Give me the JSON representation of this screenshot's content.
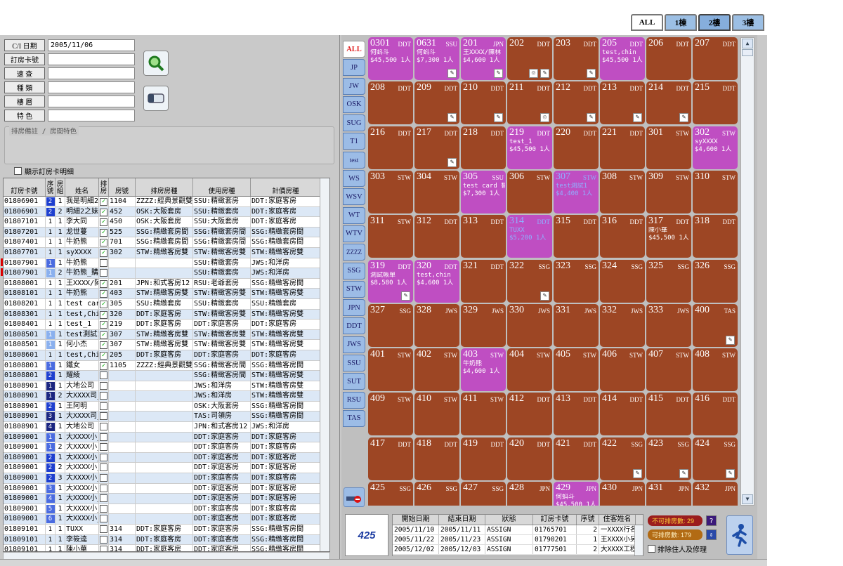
{
  "floor_tabs": [
    "ALL",
    "1棟",
    "2樓",
    "3樓"
  ],
  "form": {
    "labels": [
      "C/I 日期",
      "訂房卡號",
      "速 查",
      "種 類",
      "樓 層",
      "特 色"
    ],
    "values": [
      "2005/11/06",
      "",
      "",
      "",
      "",
      ""
    ],
    "note_label": "排房備註 / 房間特色",
    "show_card_detail": "顯示訂房卡明細"
  },
  "grid": {
    "headers": [
      "訂房卡號",
      "序號",
      "房組",
      "姓名",
      "排房",
      "房號",
      "排房房種",
      "使用房種",
      "計價房種"
    ],
    "rows": [
      [
        "01806901",
        "2",
        "b2",
        "1",
        "我是明細2",
        "c",
        "1104",
        "ZZZZ:經典景觀雙",
        "SSU:精緻套房",
        "DDT:家庭客房"
      ],
      [
        "01806901",
        "2",
        "b2",
        "2",
        "明細2之妹",
        "c",
        "452",
        "OSK:大阪套房",
        "SSU:精緻套房",
        "DDT:家庭客房"
      ],
      [
        "01807101",
        "1",
        "b0",
        "1",
        "李大同",
        "c",
        "450",
        "OSK:大阪套房",
        "SSU:大阪套房",
        "DDT:家庭客房"
      ],
      [
        "01807201",
        "1",
        "b0",
        "1",
        "龙世蔓",
        "c",
        "525",
        "SSG:精緻套房間",
        "SSG:精緻套房間",
        "SSG:精緻套房間"
      ],
      [
        "01807401",
        "1",
        "b0",
        "1",
        "牛奶熊",
        "c",
        "701",
        "SSG:精緻套房間",
        "SSG:精緻套房間",
        "SSG:精緻套房間"
      ],
      [
        "01807701",
        "1",
        "b0",
        "1",
        "syXXXX",
        "c",
        "302",
        "STW:精緻客房雙",
        "STW:精緻客房雙",
        "STW:精緻客房雙"
      ],
      [
        "01807901",
        "1",
        "b1",
        "1",
        "牛奶熊",
        "u",
        "",
        "",
        "SSU:精緻套房",
        "JWS:和洋房"
      ],
      [
        "01807901",
        "1",
        "bl",
        "2",
        "牛奶熊_購物",
        "u",
        "",
        "",
        "SSU:精緻套房",
        "JWS:和洋房"
      ],
      [
        "01808001",
        "1",
        "b0",
        "1",
        "王XXXX/陳林",
        "c",
        "201",
        "JPN:和式客房12",
        "RSU:老爺套房",
        "SSG:精緻客房間"
      ],
      [
        "01808101",
        "1",
        "b0",
        "1",
        "牛奶熊",
        "c",
        "403",
        "STW:精緻客房雙",
        "STW:精緻客房雙",
        "STW:精緻客房雙"
      ],
      [
        "01808201",
        "1",
        "b0",
        "1",
        "test card",
        "c",
        "305",
        "SSU:精緻套房",
        "SSU:精緻套房",
        "SSU:精緻套房"
      ],
      [
        "01808301",
        "1",
        "b0",
        "1",
        "test,Chin",
        "c",
        "320",
        "DDT:家庭客房",
        "STW:精緻客房雙",
        "STW:精緻客房雙"
      ],
      [
        "01808401",
        "1",
        "b0",
        "1",
        "test_1",
        "c",
        "219",
        "DDT:家庭客房",
        "DDT:家庭客房",
        "DDT:家庭客房"
      ],
      [
        "01808501",
        "1",
        "bl",
        "1",
        "test測試1",
        "c",
        "307",
        "STW:精緻客房雙",
        "STW:精緻客房雙",
        "STW:精緻客房雙"
      ],
      [
        "01808501",
        "1",
        "bl",
        "1",
        "何小杰",
        "c",
        "307",
        "STW:精緻客房雙",
        "STW:精緻客房雙",
        "STW:精緻客房雙"
      ],
      [
        "01808601",
        "1",
        "b0",
        "1",
        "test,Chin",
        "c",
        "205",
        "DDT:家庭客房",
        "DDT:家庭客房",
        "DDT:家庭客房"
      ],
      [
        "01808801",
        "1",
        "b1",
        "1",
        "鐵女",
        "c",
        "1105",
        "ZZZZ:經典景觀雙",
        "SSG:精緻客房間",
        "SSG:精緻客房間"
      ],
      [
        "01808801",
        "2",
        "b2",
        "1",
        "耀綾",
        "u",
        "",
        "",
        "SSG:精緻客房間",
        "STW:精緻客房雙"
      ],
      [
        "01808901",
        "1",
        "b3",
        "1",
        "大地公司",
        "u",
        "",
        "",
        "JWS:和洋房",
        "STW:精緻客房雙"
      ],
      [
        "01808901",
        "1",
        "b3",
        "2",
        "大XXXX司_2",
        "u",
        "",
        "",
        "JWS:和洋房",
        "STW:精緻客房雙"
      ],
      [
        "01808901",
        "2",
        "b2",
        "1",
        "王阿明",
        "u",
        "",
        "",
        "OSK:大阪套房",
        "SSG:精緻客房間"
      ],
      [
        "01808901",
        "3",
        "b3",
        "1",
        "大XXXX司_4",
        "u",
        "",
        "",
        "TAS:司領房",
        "SSG:精緻客房間"
      ],
      [
        "01808901",
        "4",
        "b3",
        "1",
        "大地公司",
        "u",
        "",
        "",
        "JPN:和式客房12",
        "JWS:和洋房"
      ],
      [
        "01809001",
        "1",
        "b1",
        "1",
        "大XXXX小_1",
        "u",
        "",
        "",
        "DDT:家庭客房",
        "DDT:家庭客房"
      ],
      [
        "01809001",
        "1",
        "b1",
        "2",
        "大XXXX小_2",
        "u",
        "",
        "",
        "DDT:家庭客房",
        "DDT:家庭客房"
      ],
      [
        "01809001",
        "2",
        "b2",
        "1",
        "大XXXX小_3",
        "u",
        "",
        "",
        "DDT:家庭客房",
        "DDT:家庭客房"
      ],
      [
        "01809001",
        "2",
        "b2",
        "2",
        "大XXXX小_4",
        "u",
        "",
        "",
        "DDT:家庭客房",
        "DDT:家庭客房"
      ],
      [
        "01809001",
        "2",
        "b2",
        "3",
        "大XXXX小_5",
        "u",
        "",
        "",
        "DDT:家庭客房",
        "DDT:家庭客房"
      ],
      [
        "01809001",
        "3",
        "b1",
        "1",
        "大XXXX小_6",
        "u",
        "",
        "",
        "DDT:家庭客房",
        "DDT:家庭客房"
      ],
      [
        "01809001",
        "4",
        "b1",
        "1",
        "大XXXX小_7",
        "u",
        "",
        "",
        "DDT:家庭客房",
        "DDT:家庭客房"
      ],
      [
        "01809001",
        "5",
        "b1",
        "1",
        "大XXXX小_1",
        "u",
        "",
        "",
        "DDT:家庭客房",
        "DDT:家庭客房"
      ],
      [
        "01809001",
        "6",
        "b1",
        "1",
        "大XXXX小_1",
        "u",
        "",
        "",
        "DDT:家庭客房",
        "DDT:家庭客房"
      ],
      [
        "01809101",
        "1",
        "b0",
        "1",
        "TUXX",
        "u",
        "314",
        "DDT:家庭客房",
        "DDT:家庭客房",
        "SSG:精緻客房間"
      ],
      [
        "01809101",
        "1",
        "b0",
        "1",
        "李筱逵",
        "u",
        "314",
        "DDT:家庭客房",
        "DDT:家庭客房",
        "SSG:精緻客房間"
      ],
      [
        "01809101",
        "1",
        "b0",
        "1",
        "陳小華",
        "u",
        "314",
        "DDT:家庭客房",
        "DDT:家庭客房",
        "SSG:精緻客房間"
      ]
    ]
  },
  "building_tabs": [
    "ALL",
    "JP",
    "JW",
    "OSK",
    "SUG",
    "T1",
    "test",
    "WS",
    "WSV",
    "WT",
    "WTV",
    "ZZZZ",
    "SSG",
    "STW",
    "JPN",
    "DDT",
    "JWS",
    "SSU",
    "SUT",
    "RSU",
    "TAS"
  ],
  "rooms": [
    [
      "0301",
      "DDT",
      "occ",
      "何蚪斗",
      "$45,500 1人",
      ""
    ],
    [
      "0631",
      "SSU",
      "occ",
      "何蚪斗",
      "$7,300 1人",
      "p"
    ],
    [
      "201",
      "JPN",
      "occ",
      "王XXXX/陳林",
      "$4,600 1人",
      "p"
    ],
    [
      "202",
      "DDT",
      "",
      "",
      "",
      "gp"
    ],
    [
      "203",
      "DDT",
      "",
      "",
      "",
      "p"
    ],
    [
      "205",
      "DDT",
      "occ",
      "test,chin",
      "$45,500 1人",
      ""
    ],
    [
      "206",
      "DDT",
      "",
      "",
      "",
      ""
    ],
    [
      "207",
      "DDT",
      "",
      "",
      "",
      ""
    ],
    [
      "208",
      "DDT",
      "",
      "",
      "",
      ""
    ],
    [
      "209",
      "DDT",
      "",
      "",
      "",
      "p"
    ],
    [
      "210",
      "DDT",
      "",
      "",
      "",
      "p"
    ],
    [
      "211",
      "DDT",
      "",
      "",
      "",
      "g"
    ],
    [
      "212",
      "DDT",
      "",
      "",
      "",
      "p"
    ],
    [
      "213",
      "DDT",
      "",
      "",
      "",
      "p"
    ],
    [
      "214",
      "DDT",
      "",
      "",
      "",
      "p"
    ],
    [
      "215",
      "DDT",
      "",
      "",
      "",
      ""
    ],
    [
      "216",
      "DDT",
      "",
      "",
      "",
      ""
    ],
    [
      "217",
      "DDT",
      "",
      "",
      "",
      "p"
    ],
    [
      "218",
      "DDT",
      "",
      "",
      "",
      ""
    ],
    [
      "219",
      "DDT",
      "occ",
      "test_1",
      "$45,500 1人",
      ""
    ],
    [
      "220",
      "DDT",
      "",
      "",
      "",
      ""
    ],
    [
      "221",
      "DDT",
      "",
      "",
      "",
      ""
    ],
    [
      "301",
      "STW",
      "",
      "",
      "",
      ""
    ],
    [
      "302",
      "STW",
      "occ",
      "syXXXX",
      "$4,600 1人",
      ""
    ],
    [
      "303",
      "STW",
      "",
      "",
      "",
      ""
    ],
    [
      "304",
      "STW",
      "",
      "",
      "",
      ""
    ],
    [
      "305",
      "SSU",
      "occ",
      "test card 替",
      "$7,300 1人",
      ""
    ],
    [
      "306",
      "STW",
      "",
      "",
      "",
      ""
    ],
    [
      "307",
      "STW",
      "sel",
      "test測試1",
      "$4,400 1人",
      ""
    ],
    [
      "308",
      "STW",
      "",
      "",
      "",
      ""
    ],
    [
      "309",
      "STW",
      "",
      "",
      "",
      ""
    ],
    [
      "310",
      "STW",
      "",
      "",
      "",
      ""
    ],
    [
      "311",
      "STW",
      "",
      "",
      "",
      ""
    ],
    [
      "312",
      "DDT",
      "",
      "",
      "",
      ""
    ],
    [
      "313",
      "DDT",
      "",
      "",
      "",
      ""
    ],
    [
      "314",
      "DDT",
      "sel",
      "TUXX",
      "$5,200 1人",
      ""
    ],
    [
      "315",
      "DDT",
      "",
      "",
      "",
      ""
    ],
    [
      "316",
      "DDT",
      "",
      "",
      "",
      ""
    ],
    [
      "317",
      "DDT",
      "",
      "陳小華",
      "$45,500 1人",
      ""
    ],
    [
      "318",
      "DDT",
      "",
      "",
      "",
      ""
    ],
    [
      "319",
      "DDT",
      "occ",
      "測試帳單",
      "$8,580 1人",
      "p"
    ],
    [
      "320",
      "DDT",
      "occ",
      "test,chin",
      "$4,600 1人",
      ""
    ],
    [
      "321",
      "DDT",
      "",
      "",
      "",
      ""
    ],
    [
      "322",
      "SSG",
      "",
      "",
      "",
      "p"
    ],
    [
      "323",
      "SSG",
      "",
      "",
      "",
      ""
    ],
    [
      "324",
      "SSG",
      "",
      "",
      "",
      ""
    ],
    [
      "325",
      "SSG",
      "",
      "",
      "",
      ""
    ],
    [
      "326",
      "SSG",
      "",
      "",
      "",
      ""
    ],
    [
      "327",
      "SSG",
      "",
      "",
      "",
      ""
    ],
    [
      "328",
      "JWS",
      "",
      "",
      "",
      ""
    ],
    [
      "329",
      "JWS",
      "",
      "",
      "",
      ""
    ],
    [
      "330",
      "JWS",
      "",
      "",
      "",
      ""
    ],
    [
      "331",
      "JWS",
      "",
      "",
      "",
      ""
    ],
    [
      "332",
      "JWS",
      "",
      "",
      "",
      ""
    ],
    [
      "333",
      "JWS",
      "",
      "",
      "",
      ""
    ],
    [
      "400",
      "TAS",
      "",
      "",
      "",
      "p"
    ],
    [
      "401",
      "STW",
      "",
      "",
      "",
      ""
    ],
    [
      "402",
      "STW",
      "",
      "",
      "",
      ""
    ],
    [
      "403",
      "STW",
      "occ",
      "牛奶熊",
      "$4,600 1人",
      ""
    ],
    [
      "404",
      "STW",
      "",
      "",
      "",
      ""
    ],
    [
      "405",
      "STW",
      "",
      "",
      "",
      ""
    ],
    [
      "406",
      "STW",
      "",
      "",
      "",
      ""
    ],
    [
      "407",
      "STW",
      "",
      "",
      "",
      ""
    ],
    [
      "408",
      "STW",
      "",
      "",
      "",
      ""
    ],
    [
      "409",
      "STW",
      "",
      "",
      "",
      ""
    ],
    [
      "410",
      "STW",
      "",
      "",
      "",
      ""
    ],
    [
      "411",
      "STW",
      "",
      "",
      "",
      ""
    ],
    [
      "412",
      "DDT",
      "",
      "",
      "",
      ""
    ],
    [
      "413",
      "DDT",
      "",
      "",
      "",
      ""
    ],
    [
      "414",
      "DDT",
      "",
      "",
      "",
      ""
    ],
    [
      "415",
      "DDT",
      "",
      "",
      "",
      ""
    ],
    [
      "416",
      "DDT",
      "",
      "",
      "",
      ""
    ],
    [
      "417",
      "DDT",
      "",
      "",
      "",
      ""
    ],
    [
      "418",
      "DDT",
      "",
      "",
      "",
      ""
    ],
    [
      "419",
      "DDT",
      "",
      "",
      "",
      ""
    ],
    [
      "420",
      "DDT",
      "",
      "",
      "",
      ""
    ],
    [
      "421",
      "DDT",
      "",
      "",
      "",
      ""
    ],
    [
      "422",
      "SSG",
      "",
      "",
      "",
      "p"
    ],
    [
      "423",
      "SSG",
      "",
      "",
      "",
      "p"
    ],
    [
      "424",
      "SSG",
      "",
      "",
      "",
      "p"
    ],
    [
      "425",
      "SSG",
      "",
      "",
      "",
      ""
    ],
    [
      "426",
      "SSG",
      "",
      "",
      "",
      ""
    ],
    [
      "427",
      "SSG",
      "",
      "",
      "",
      ""
    ],
    [
      "428",
      "JPN",
      "",
      "",
      "",
      ""
    ],
    [
      "429",
      "JPN",
      "occ",
      "何蚪斗",
      "$45,500 1人",
      ""
    ],
    [
      "430",
      "JPN",
      "",
      "",
      "",
      ""
    ],
    [
      "431",
      "JPN",
      "",
      "",
      "",
      ""
    ],
    [
      "432",
      "JPN",
      "",
      "",
      "",
      ""
    ]
  ],
  "selected_room": "425",
  "assign": {
    "headers": [
      "開始日期",
      "結束日期",
      "狀態",
      "訂房卡號",
      "序號",
      "住客姓名"
    ],
    "rows": [
      [
        "2005/11/10",
        "2005/11/11",
        "ASSIGN",
        "01765701",
        "2",
        "一XXXX行名"
      ],
      [
        "2005/11/22",
        "2005/11/23",
        "ASSIGN",
        "01790201",
        "1",
        "王XXXX小另"
      ],
      [
        "2005/12/02",
        "2005/12/03",
        "ASSIGN",
        "01777501",
        "2",
        "大XXXX工程"
      ]
    ]
  },
  "stats": {
    "unavailable": "不可排房數: 29",
    "available": "可排房數: 179",
    "exclude": "排除住人及修理"
  },
  "colors": {
    "room_vacant": "#9d4624",
    "room_occupied": "#bf4ec2"
  }
}
